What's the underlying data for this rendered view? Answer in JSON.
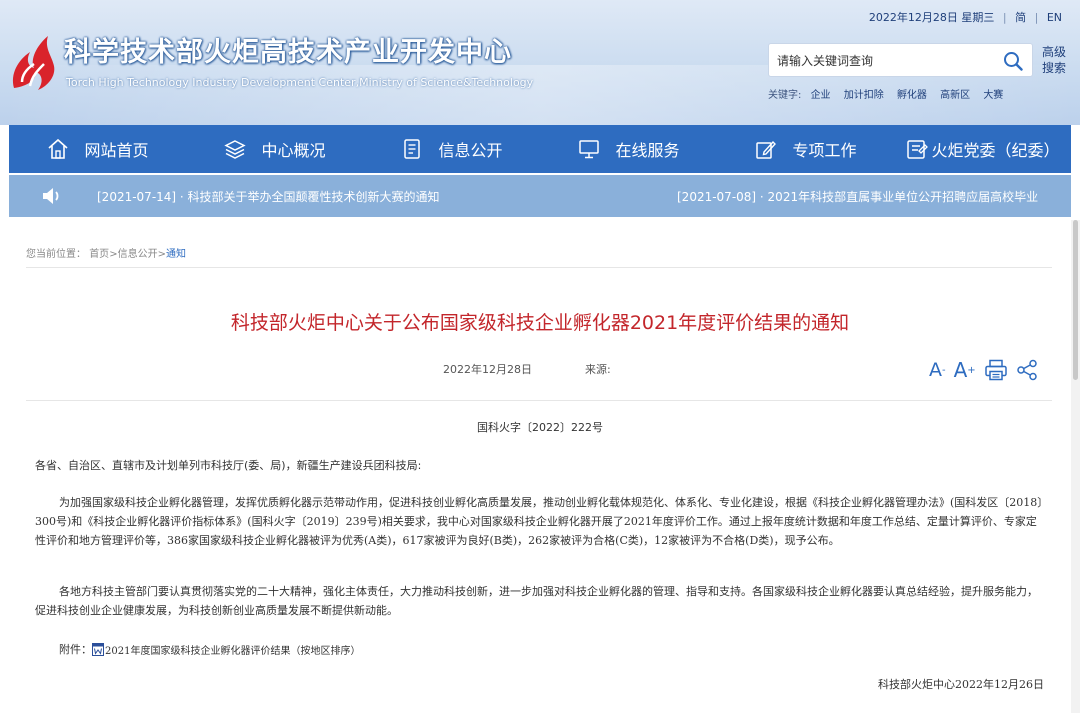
{
  "header": {
    "site_title": "科学技术部火炬高技术产业开发中心",
    "site_subtitle": "Torch High Technology Industry Development Center,Ministry of Science&Technology",
    "date": "2022年12月28日 星期三",
    "lang_simplified": "简",
    "lang_english": "EN",
    "search_placeholder": "请输入关键词查询",
    "advanced_search": "高级搜索",
    "keywords_label": "关键字:",
    "keywords": [
      "企业",
      "加计扣除",
      "孵化器",
      "高新区",
      "大赛"
    ]
  },
  "nav": {
    "items": [
      {
        "label": "网站首页",
        "icon": "home-icon"
      },
      {
        "label": "中心概况",
        "icon": "layers-icon"
      },
      {
        "label": "信息公开",
        "icon": "document-icon"
      },
      {
        "label": "在线服务",
        "icon": "monitor-icon"
      },
      {
        "label": "专项工作",
        "icon": "edit-icon"
      },
      {
        "label": "火炬党委（纪委）",
        "icon": "party-icon"
      }
    ]
  },
  "ticker": {
    "items": [
      "[2021-07-14] · 科技部关于举办全国颠覆性技术创新大赛的通知",
      "[2021-07-08] · 2021年科技部直属事业单位公开招聘应届高校毕业"
    ]
  },
  "breadcrumb": {
    "label": "您当前位置：",
    "home": "首页",
    "sep1": ">",
    "info": "信息公开",
    "sep2": ">",
    "current": "通知"
  },
  "article": {
    "title": "科技部火炬中心关于公布国家级科技企业孵化器2021年度评价结果的通知",
    "date": "2022年12月28日",
    "source_label": "来源:",
    "doc_number": "国科火字〔2022〕222号",
    "salutation": "各省、自治区、直辖市及计划单列市科技厅(委、局)，新疆生产建设兵团科技局:",
    "paragraph1": "为加强国家级科技企业孵化器管理，发挥优质孵化器示范带动作用，促进科技创业孵化高质量发展，推动创业孵化载体规范化、体系化、专业化建设，根据《科技企业孵化器管理办法》(国科发区〔2018〕300号)和《科技企业孵化器评价指标体系》(国科火字〔2019〕239号)相关要求，我中心对国家级科技企业孵化器开展了2021年度评价工作。通过上报年度统计数据和年度工作总结、定量计算评价、专家定性评价和地方管理评价等，386家国家级科技企业孵化器被评为优秀(A类)，617家被评为良好(B类)，262家被评为合格(C类)，12家被评为不合格(D类)，现予公布。",
    "paragraph2": "各地方科技主管部门要认真贯彻落实党的二十大精神，强化主体责任，大力推动科技创新，进一步加强对科技企业孵化器的管理、指导和支持。各国家级科技企业孵化器要认真总结经验，提升服务能力，促进科技创业企业健康发展，为科技创新创业高质量发展不断提供新动能。",
    "attachment_label": "附件：",
    "attachment_name": "2021年度国家级科技企业孵化器评价结果（按地区排序）",
    "signature": "科技部火炬中心2022年12月26日"
  },
  "tools": {
    "font_small": "A",
    "font_small_sup": "-",
    "font_large": "A",
    "font_large_sup": "+"
  },
  "colors": {
    "nav_bg": "#2e6cc0",
    "ticker_bg": "#8ab0da",
    "title_red": "#c3262b",
    "logo_red": "#d9232b"
  }
}
